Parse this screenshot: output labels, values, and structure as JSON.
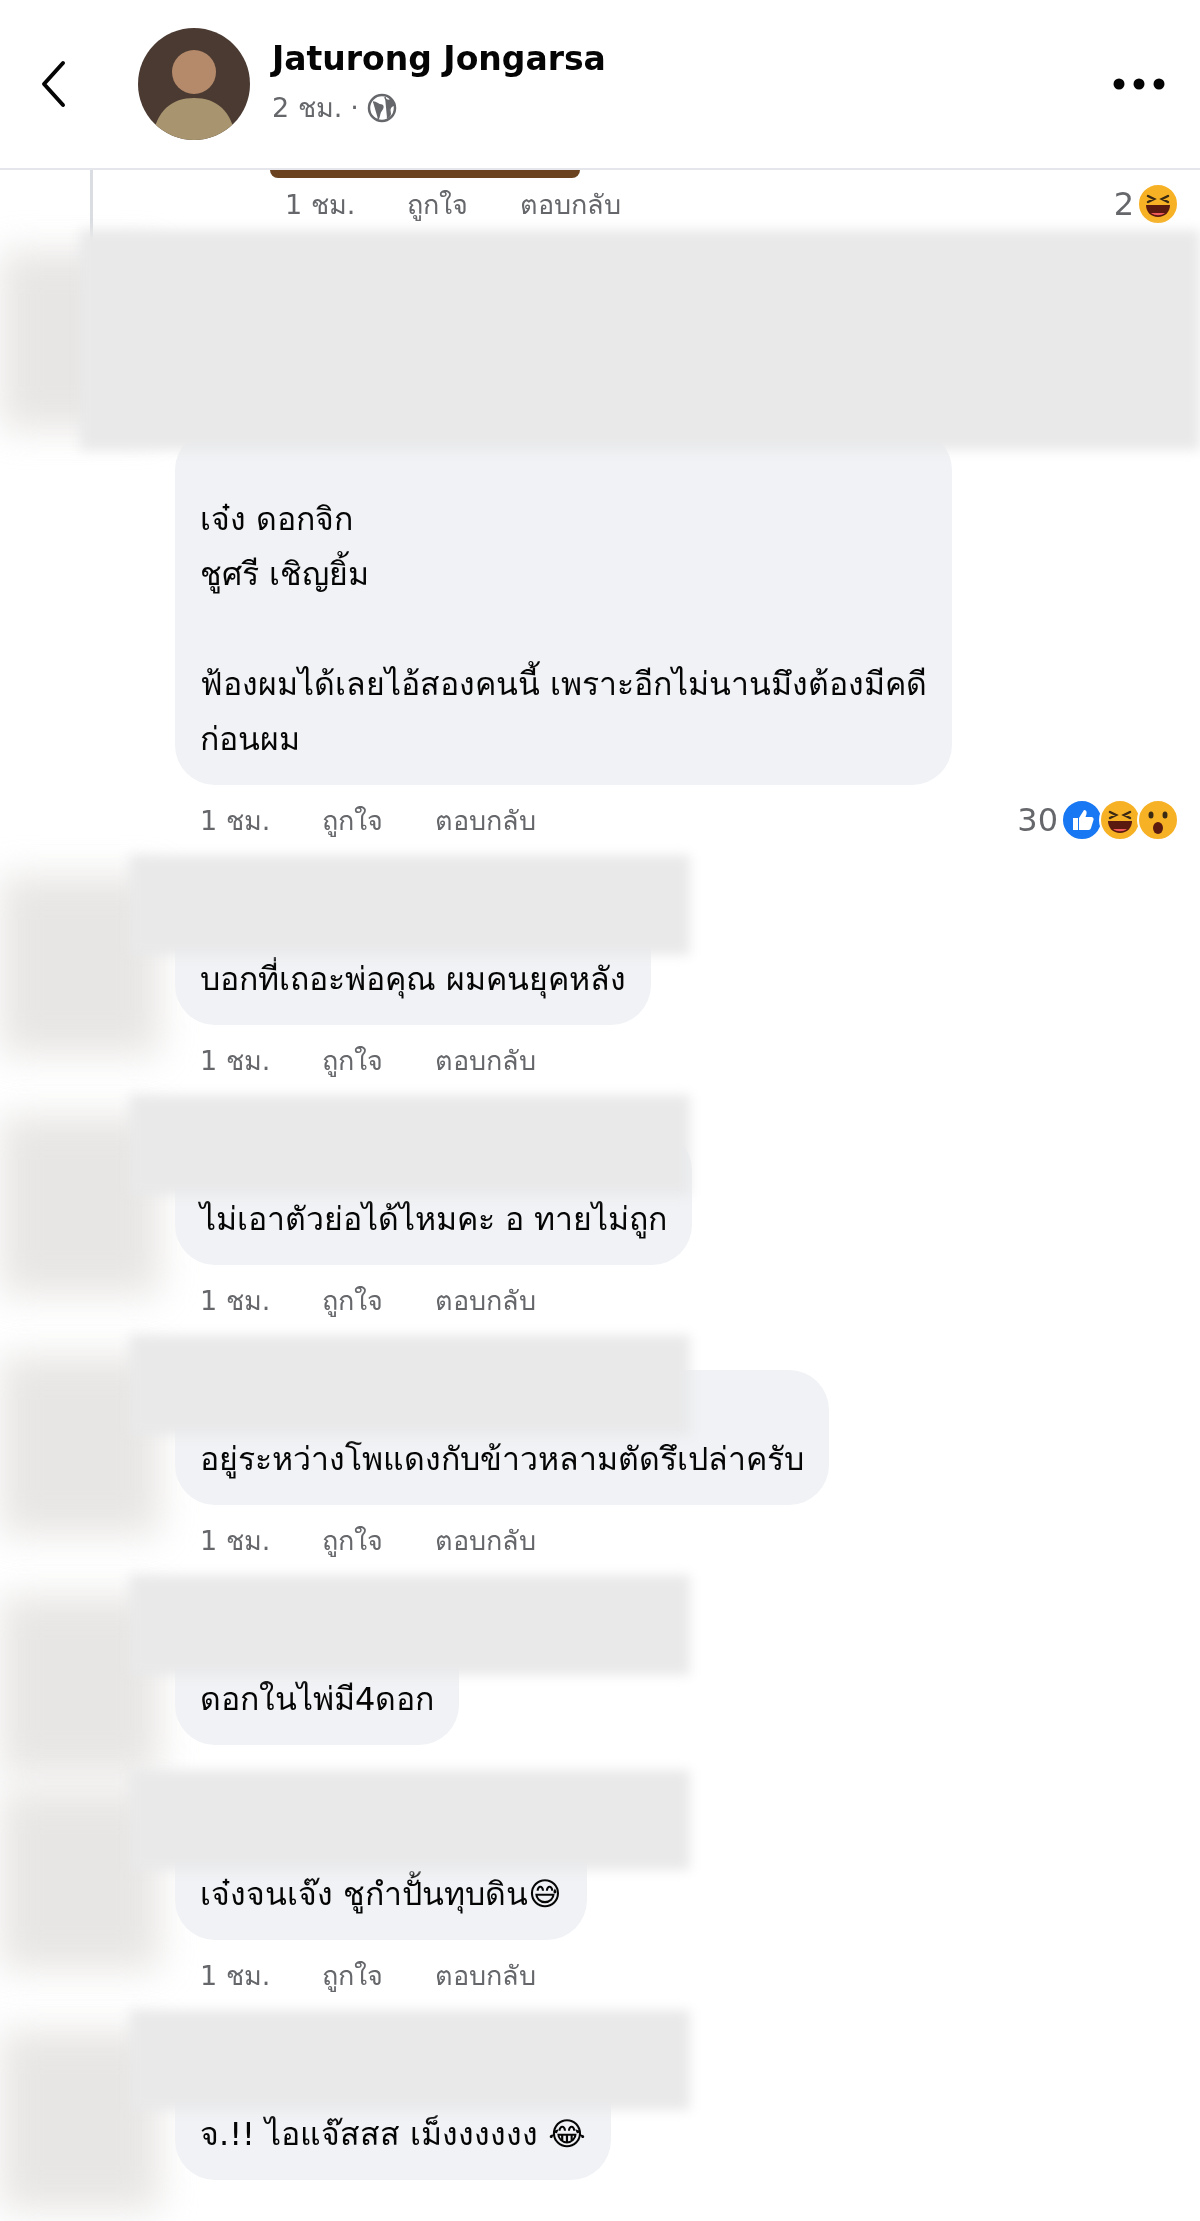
{
  "header": {
    "author": "Jaturong Jongarsa",
    "time": "2 ชม.",
    "separator": "·"
  },
  "top_reply": {
    "time": "1 ชม.",
    "like_label": "ถูกใจ",
    "reply_label": "ตอบกลับ",
    "reactions": {
      "count": "2",
      "icons": [
        {
          "kind": "haha"
        }
      ]
    }
  },
  "comments": [
    {
      "text": "เจ๋ง ดอกจิก\nชูศรี เชิญยิ้ม\n\nฟ้องผมได้เลยไอ้สองคนนี้ เพราะอีกไม่นานมึงต้องมีคดี\nก่อนผม",
      "time": "1 ชม.",
      "like_label": "ถูกใจ",
      "reply_label": "ตอบกลับ",
      "reactions": {
        "count": "30",
        "icons": [
          {
            "kind": "like"
          },
          {
            "kind": "haha"
          },
          {
            "kind": "wow"
          }
        ]
      }
    },
    {
      "text": "บอกที่เถอะพ่อคุณ ผมคนยุคหลัง",
      "time": "1 ชม.",
      "like_label": "ถูกใจ",
      "reply_label": "ตอบกลับ"
    },
    {
      "text": "ไม่เอาตัวย่อได้ไหมคะ อ ทายไม่ถูก",
      "time": "1 ชม.",
      "like_label": "ถูกใจ",
      "reply_label": "ตอบกลับ"
    },
    {
      "text": "อยู่ระหว่างโพแดงกับข้าวหลามตัดรึเปล่าครับ",
      "time": "1 ชม.",
      "like_label": "ถูกใจ",
      "reply_label": "ตอบกลับ"
    },
    {
      "text": "ดอกในไพ่มี4ดอก"
    },
    {
      "text": "เจ๋งจนเจ๊ง ชูกำปั้นทุบดิน😅",
      "time": "1 ชม.",
      "like_label": "ถูกใจ",
      "reply_label": "ตอบกลับ"
    },
    {
      "text": "จ.!! ไอแจ๊สสส เม็งงงงงง 😂"
    }
  ]
}
